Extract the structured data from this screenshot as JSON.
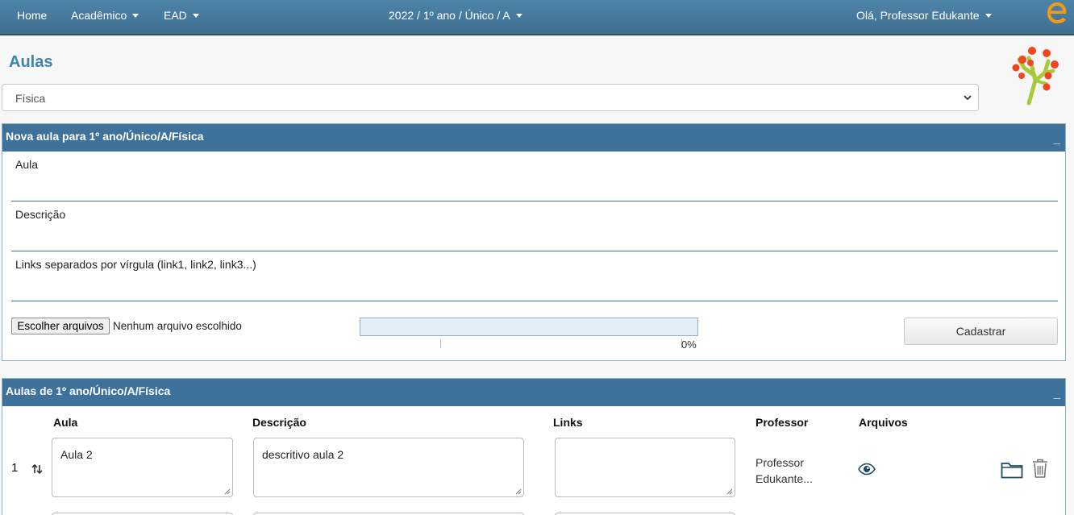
{
  "navbar": {
    "home": "Home",
    "academico": "Acadêmico",
    "ead": "EAD",
    "context": "2022 / 1º ano / Único / A",
    "greeting": "Olá, Professor Edukante",
    "brand_icon": "edukante-e-logo",
    "brand_color": "#f39c12"
  },
  "page": {
    "title": "Aulas",
    "logo_icon": "tree-logo"
  },
  "subject_select": {
    "value": "Física"
  },
  "new_lesson_panel": {
    "title": "Nova aula para 1º ano/Único/A/Física",
    "collapse_label": "_",
    "field_aula": "Aula",
    "field_descricao": "Descrição",
    "field_links": "Links separados por vírgula (link1, link2, link3...)",
    "file_button": "Escolher arquivos",
    "file_status": "Nenhum arquivo escolhido",
    "progress_percent": 0,
    "progress_label": "0%",
    "submit_label": "Cadastrar"
  },
  "lessons_panel": {
    "title": "Aulas de 1º ano/Único/A/Física",
    "collapse_label": "_",
    "columns": [
      "Aula",
      "Descrição",
      "Links",
      "Professor",
      "Arquivos"
    ],
    "rows": [
      {
        "index": "1",
        "aula": "Aula 2",
        "descricao": "descritivo aula 2",
        "links": "",
        "professor_line1": "Professor",
        "professor_line2": "Edukante..."
      }
    ]
  },
  "colors": {
    "navbar": "#4a7ea3",
    "panel_header": "#3f729a",
    "title": "#3d84ac"
  }
}
